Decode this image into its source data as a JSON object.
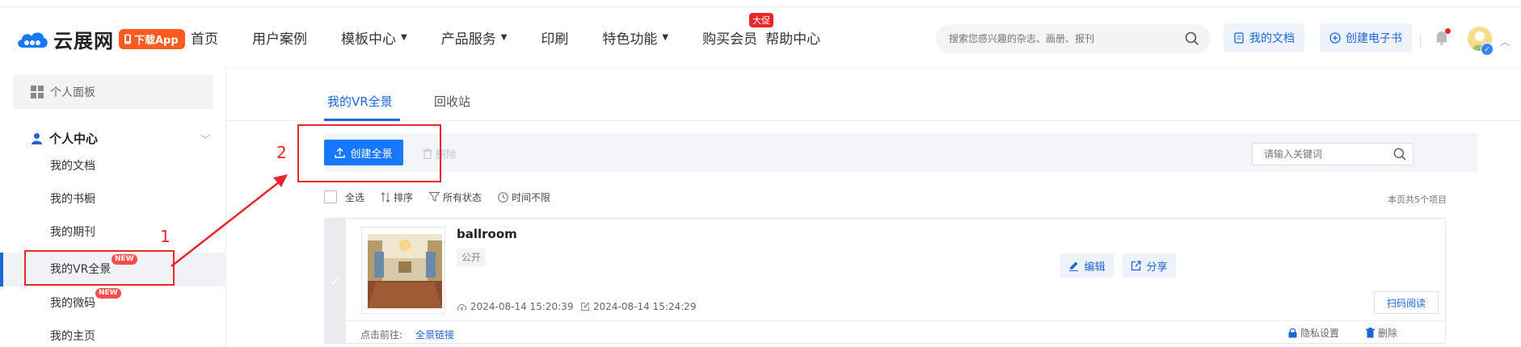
{
  "header": {
    "logo_text": "云展网",
    "download_app": "下载App",
    "nav": [
      {
        "label": "首页",
        "caret": false
      },
      {
        "label": "用户案例",
        "caret": false
      },
      {
        "label": "模板中心",
        "caret": true
      },
      {
        "label": "产品服务",
        "caret": true
      },
      {
        "label": "印刷",
        "caret": false
      },
      {
        "label": "特色功能",
        "caret": true
      },
      {
        "label": "购买会员",
        "caret": false,
        "badge": "大促"
      },
      {
        "label": "帮助中心",
        "caret": false
      }
    ],
    "search_placeholder": "搜索您感兴趣的杂志、画册、报刊",
    "my_docs_label": "我的文档",
    "create_ebook_label": "创建电子书"
  },
  "sidebar": {
    "panel_label": "个人面板",
    "center_label": "个人中心",
    "items": [
      {
        "label": "我的文档",
        "new": false
      },
      {
        "label": "我的书橱",
        "new": false
      },
      {
        "label": "我的期刊",
        "new": false
      },
      {
        "label": "我的VR全景",
        "new": true,
        "active": true
      },
      {
        "label": "我的微码",
        "new": true
      },
      {
        "label": "我的主页",
        "new": false
      }
    ],
    "new_badge": "NEW"
  },
  "main": {
    "tabs": [
      {
        "label": "我的VR全景",
        "active": true
      },
      {
        "label": "回收站",
        "active": false
      }
    ],
    "toolbar": {
      "create_label": "创建全景",
      "delete_label": "删除",
      "keyword_placeholder": "请输入关键词"
    },
    "filters": {
      "select_all": "全选",
      "sort": "排序",
      "status": "所有状态",
      "time": "时间不限"
    },
    "count_text": "本页共5个项目",
    "item": {
      "title": "ballroom",
      "tag": "公开",
      "created": "2024-08-14 15:20:39",
      "modified": "2024-08-14 15:24:29",
      "edit_label": "编辑",
      "share_label": "分享",
      "scan_label": "扫码阅读",
      "goto_label": "点击前往:",
      "panorama_link": "全景链接",
      "privacy_label": "隐私设置",
      "delete_label": "删除"
    }
  },
  "annotations": {
    "step1": "1",
    "step2": "2"
  },
  "colors": {
    "brand_blue": "#1677ff",
    "link_blue": "#1a66d6",
    "annotation_red": "#e8262b",
    "app_orange": "#ff5a1f"
  }
}
